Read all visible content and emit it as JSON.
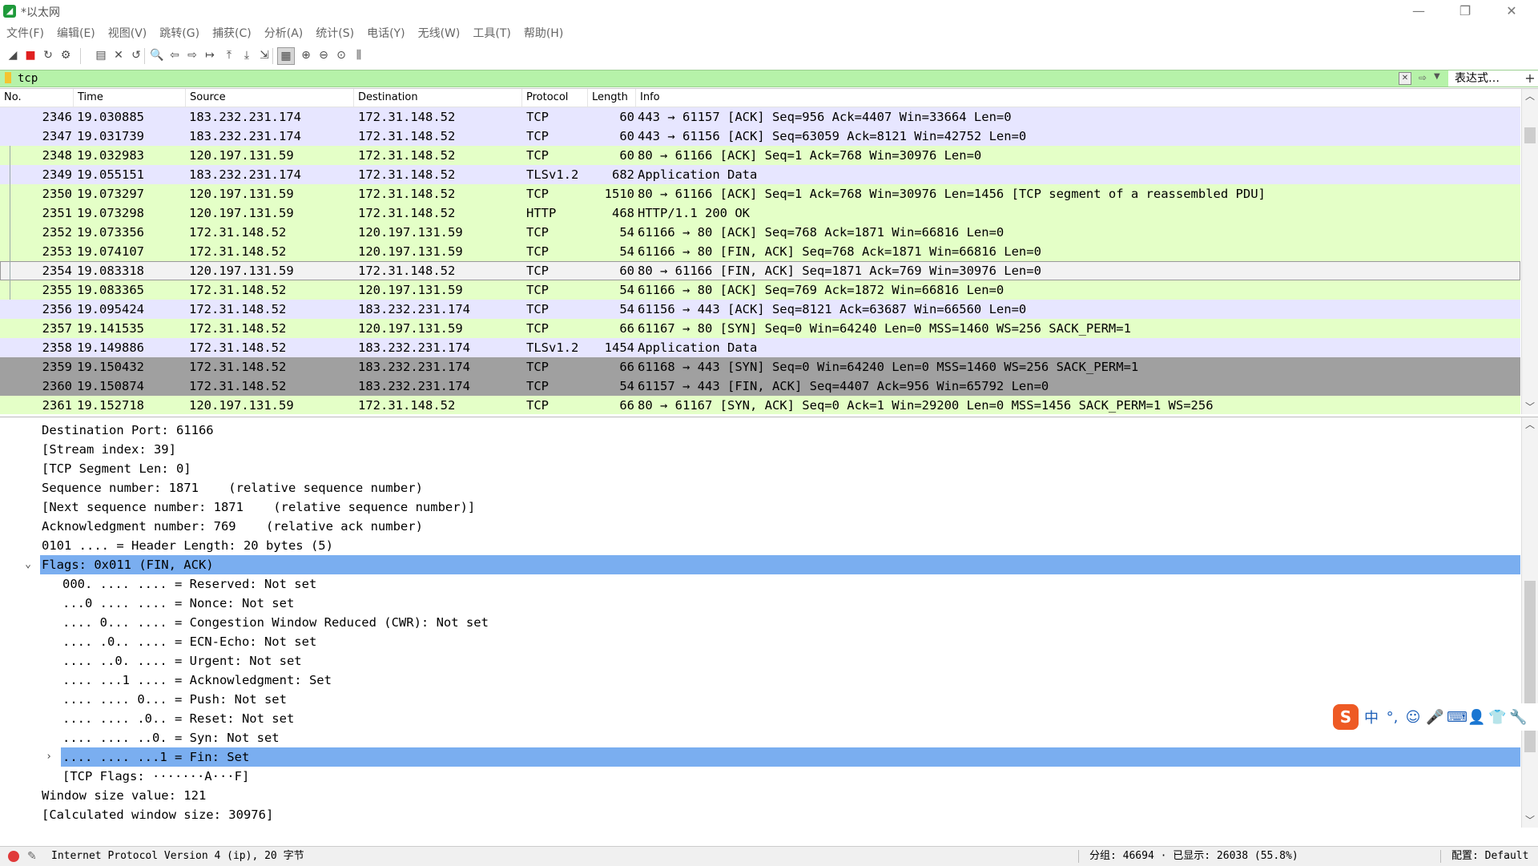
{
  "window": {
    "title": "*以太网",
    "minimize": "—",
    "restore": "❐",
    "close": "✕"
  },
  "menu": [
    "文件(F)",
    "编辑(E)",
    "视图(V)",
    "跳转(G)",
    "捕获(C)",
    "分析(A)",
    "统计(S)",
    "电话(Y)",
    "无线(W)",
    "工具(T)",
    "帮助(H)"
  ],
  "toolbar": {
    "icons": [
      "shark-fin-start-icon",
      "stop-capture-icon",
      "restart-capture-icon",
      "capture-options-icon",
      "open-file-icon",
      "close-file-icon",
      "reload-icon",
      "find-packet-icon",
      "go-back-icon",
      "go-forward-icon",
      "go-to-packet-icon",
      "first-packet-icon",
      "last-packet-icon",
      "auto-scroll-icon",
      "colorize-icon",
      "zoom-in-icon",
      "zoom-out-icon",
      "normal-size-icon",
      "resize-columns-icon"
    ]
  },
  "filter": {
    "value": "tcp",
    "expression_button": "表达式…",
    "add_button": "+"
  },
  "columns": [
    "No.",
    "Time",
    "Source",
    "Destination",
    "Protocol",
    "Length",
    "Info"
  ],
  "packets": [
    {
      "no": "2346",
      "time": "19.030885",
      "src": "183.232.231.174",
      "dst": "172.31.148.52",
      "proto": "TCP",
      "len": "60",
      "info": "443 → 61157 [ACK] Seq=956 Ack=4407 Win=33664 Len=0",
      "bg": "#e7e6ff"
    },
    {
      "no": "2347",
      "time": "19.031739",
      "src": "183.232.231.174",
      "dst": "172.31.148.52",
      "proto": "TCP",
      "len": "60",
      "info": "443 → 61156 [ACK] Seq=63059 Ack=8121 Win=42752 Len=0",
      "bg": "#e7e6ff"
    },
    {
      "no": "2348",
      "time": "19.032983",
      "src": "120.197.131.59",
      "dst": "172.31.148.52",
      "proto": "TCP",
      "len": "60",
      "info": "80 → 61166 [ACK] Seq=1 Ack=768 Win=30976 Len=0",
      "bg": "#e4ffc7"
    },
    {
      "no": "2349",
      "time": "19.055151",
      "src": "183.232.231.174",
      "dst": "172.31.148.52",
      "proto": "TLSv1.2",
      "len": "682",
      "info": "Application Data",
      "bg": "#e7e6ff"
    },
    {
      "no": "2350",
      "time": "19.073297",
      "src": "120.197.131.59",
      "dst": "172.31.148.52",
      "proto": "TCP",
      "len": "1510",
      "info": "80 → 61166 [ACK] Seq=1 Ack=768 Win=30976 Len=1456 [TCP segment of a reassembled PDU]",
      "bg": "#e4ffc7"
    },
    {
      "no": "2351",
      "time": "19.073298",
      "src": "120.197.131.59",
      "dst": "172.31.148.52",
      "proto": "HTTP",
      "len": "468",
      "info": "HTTP/1.1 200 OK",
      "bg": "#e4ffc7"
    },
    {
      "no": "2352",
      "time": "19.073356",
      "src": "172.31.148.52",
      "dst": "120.197.131.59",
      "proto": "TCP",
      "len": "54",
      "info": "61166 → 80 [ACK] Seq=768 Ack=1871 Win=66816 Len=0",
      "bg": "#e4ffc7"
    },
    {
      "no": "2353",
      "time": "19.074107",
      "src": "172.31.148.52",
      "dst": "120.197.131.59",
      "proto": "TCP",
      "len": "54",
      "info": "61166 → 80 [FIN, ACK] Seq=768 Ack=1871 Win=66816 Len=0",
      "bg": "#e4ffc7"
    },
    {
      "no": "2354",
      "time": "19.083318",
      "src": "120.197.131.59",
      "dst": "172.31.148.52",
      "proto": "TCP",
      "len": "60",
      "info": "80 → 61166 [FIN, ACK] Seq=1871 Ack=769 Win=30976 Len=0",
      "bg": "#f2f2f2"
    },
    {
      "no": "2355",
      "time": "19.083365",
      "src": "172.31.148.52",
      "dst": "120.197.131.59",
      "proto": "TCP",
      "len": "54",
      "info": "61166 → 80 [ACK] Seq=769 Ack=1872 Win=66816 Len=0",
      "bg": "#e4ffc7"
    },
    {
      "no": "2356",
      "time": "19.095424",
      "src": "172.31.148.52",
      "dst": "183.232.231.174",
      "proto": "TCP",
      "len": "54",
      "info": "61156 → 443 [ACK] Seq=8121 Ack=63687 Win=66560 Len=0",
      "bg": "#e7e6ff"
    },
    {
      "no": "2357",
      "time": "19.141535",
      "src": "172.31.148.52",
      "dst": "120.197.131.59",
      "proto": "TCP",
      "len": "66",
      "info": "61167 → 80 [SYN] Seq=0 Win=64240 Len=0 MSS=1460 WS=256 SACK_PERM=1",
      "bg": "#e4ffc7"
    },
    {
      "no": "2358",
      "time": "19.149886",
      "src": "172.31.148.52",
      "dst": "183.232.231.174",
      "proto": "TLSv1.2",
      "len": "1454",
      "info": "Application Data",
      "bg": "#e7e6ff"
    },
    {
      "no": "2359",
      "time": "19.150432",
      "src": "172.31.148.52",
      "dst": "183.232.231.174",
      "proto": "TCP",
      "len": "66",
      "info": "61168 → 443 [SYN] Seq=0 Win=64240 Len=0 MSS=1460 WS=256 SACK_PERM=1",
      "bg": "#a0a0a0"
    },
    {
      "no": "2360",
      "time": "19.150874",
      "src": "172.31.148.52",
      "dst": "183.232.231.174",
      "proto": "TCP",
      "len": "54",
      "info": "61157 → 443 [FIN, ACK] Seq=4407 Ack=956 Win=65792 Len=0",
      "bg": "#a0a0a0"
    },
    {
      "no": "2361",
      "time": "19.152718",
      "src": "120.197.131.59",
      "dst": "172.31.148.52",
      "proto": "TCP",
      "len": "66",
      "info": "80 → 61167 [SYN, ACK] Seq=0 Ack=1 Win=29200 Len=0 MSS=1456 SACK_PERM=1 WS=256",
      "bg": "#e4ffc7"
    }
  ],
  "details": [
    {
      "indent": 1,
      "toggle": "",
      "text": "Destination Port: 61166",
      "selected": false
    },
    {
      "indent": 1,
      "toggle": "",
      "text": "[Stream index: 39]",
      "selected": false
    },
    {
      "indent": 1,
      "toggle": "",
      "text": "[TCP Segment Len: 0]",
      "selected": false
    },
    {
      "indent": 1,
      "toggle": "",
      "text": "Sequence number: 1871    (relative sequence number)",
      "selected": false
    },
    {
      "indent": 1,
      "toggle": "",
      "text": "[Next sequence number: 1871    (relative sequence number)]",
      "selected": false
    },
    {
      "indent": 1,
      "toggle": "",
      "text": "Acknowledgment number: 769    (relative ack number)",
      "selected": false
    },
    {
      "indent": 1,
      "toggle": "",
      "text": "0101 .... = Header Length: 20 bytes (5)",
      "selected": false
    },
    {
      "indent": 1,
      "toggle": "⌄",
      "text": "Flags: 0x011 (FIN, ACK)",
      "selected": true
    },
    {
      "indent": 2,
      "toggle": "",
      "text": "000. .... .... = Reserved: Not set",
      "selected": false
    },
    {
      "indent": 2,
      "toggle": "",
      "text": "...0 .... .... = Nonce: Not set",
      "selected": false
    },
    {
      "indent": 2,
      "toggle": "",
      "text": ".... 0... .... = Congestion Window Reduced (CWR): Not set",
      "selected": false
    },
    {
      "indent": 2,
      "toggle": "",
      "text": ".... .0.. .... = ECN-Echo: Not set",
      "selected": false
    },
    {
      "indent": 2,
      "toggle": "",
      "text": ".... ..0. .... = Urgent: Not set",
      "selected": false
    },
    {
      "indent": 2,
      "toggle": "",
      "text": ".... ...1 .... = Acknowledgment: Set",
      "selected": false
    },
    {
      "indent": 2,
      "toggle": "",
      "text": ".... .... 0... = Push: Not set",
      "selected": false
    },
    {
      "indent": 2,
      "toggle": "",
      "text": ".... .... .0.. = Reset: Not set",
      "selected": false
    },
    {
      "indent": 2,
      "toggle": "",
      "text": ".... .... ..0. = Syn: Not set",
      "selected": false
    },
    {
      "indent": 2,
      "toggle": "›",
      "text": ".... .... ...1 = Fin: Set",
      "selected": true
    },
    {
      "indent": 2,
      "toggle": "",
      "text": "[TCP Flags: ·······A···F]",
      "selected": false
    },
    {
      "indent": 1,
      "toggle": "",
      "text": "Window size value: 121",
      "selected": false
    },
    {
      "indent": 1,
      "toggle": "",
      "text": "[Calculated window size: 30976]",
      "selected": false
    }
  ],
  "ime": {
    "logo": "S",
    "items": [
      "中",
      "°,",
      "☺",
      "🎤",
      "⌨",
      "👤",
      "👕",
      "🔧"
    ]
  },
  "status": {
    "left": "Internet Protocol Version 4 (ip), 20 字节",
    "mid": "分组: 46694 · 已显示: 26038 (55.8%)",
    "right": "配置: Default"
  },
  "colors": {
    "tcp_row": "#e7e6ff",
    "http_row": "#e4ffc7",
    "bad_row": "#a0a0a0",
    "selection": "#7aaef0",
    "filter_ok": "#b6f2a9"
  }
}
